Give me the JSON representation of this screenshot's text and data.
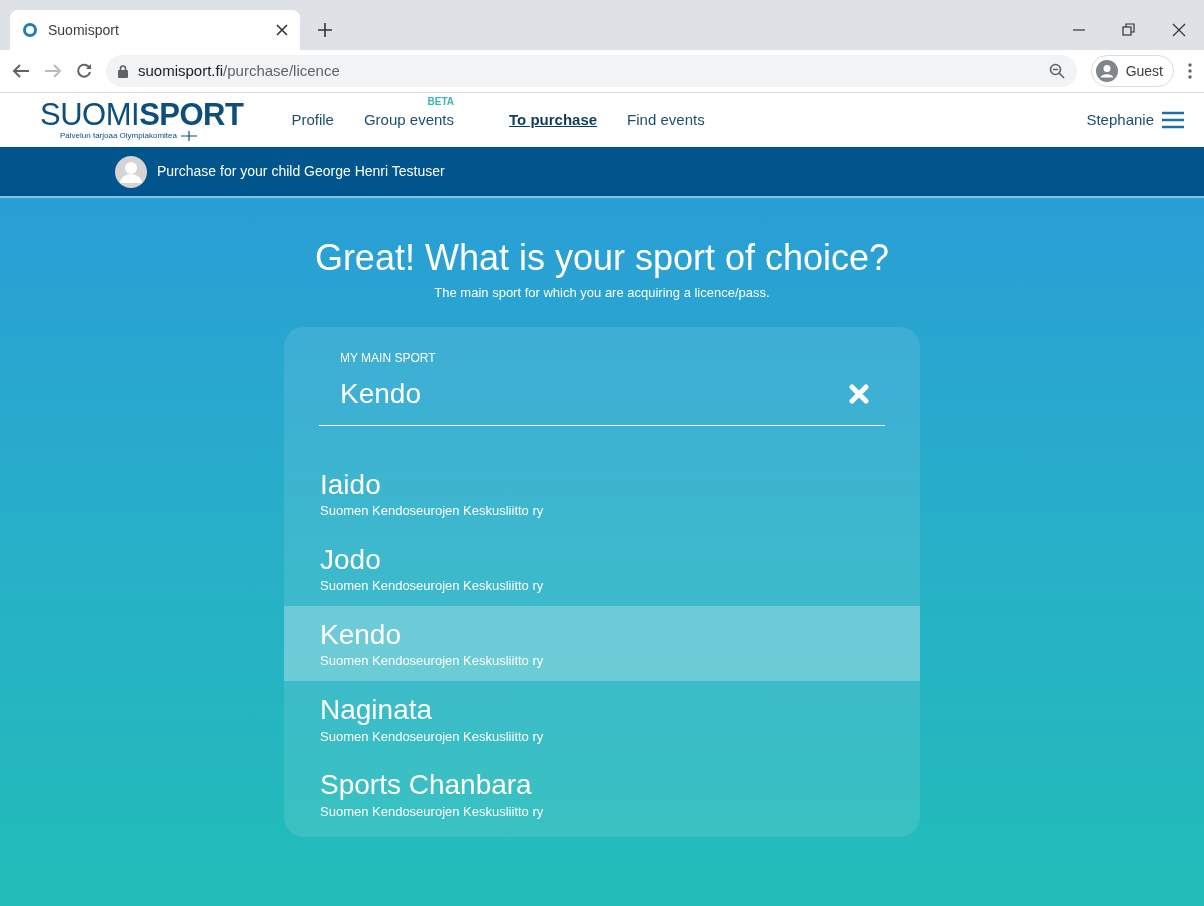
{
  "browser": {
    "tab_title": "Suomisport",
    "url_host": "suomisport.fi",
    "url_path": "/purchase/licence",
    "profile": "Guest"
  },
  "logo": {
    "light": "SUOMI",
    "bold": "SPORT",
    "tagline": "Palvelun tarjoaa Olympiakomitea"
  },
  "nav": [
    {
      "label": "Profile",
      "selected": false
    },
    {
      "label": "Group events",
      "badge": "BETA",
      "selected": false
    },
    {
      "label": "To purchase",
      "selected": true
    },
    {
      "label": "Find events",
      "selected": false
    }
  ],
  "user": "Stephanie",
  "banner": "Purchase for your child George Henri Testuser",
  "heading": "Great! What is your sport of choice?",
  "subheading": "The main sport for which you are acquiring a licence/pass.",
  "field": {
    "label": "MY MAIN SPORT",
    "value": "Kendo"
  },
  "results": [
    {
      "name": "Iaido",
      "org": "Suomen Kendoseurojen Keskusliitto ry",
      "selected": false
    },
    {
      "name": "Jodo",
      "org": "Suomen Kendoseurojen Keskusliitto ry",
      "selected": false
    },
    {
      "name": "Kendo",
      "org": "Suomen Kendoseurojen Keskusliitto ry",
      "selected": true
    },
    {
      "name": "Naginata",
      "org": "Suomen Kendoseurojen Keskusliitto ry",
      "selected": false
    },
    {
      "name": "Sports Chanbara",
      "org": "Suomen Kendoseurojen Keskusliitto ry",
      "selected": false
    }
  ]
}
